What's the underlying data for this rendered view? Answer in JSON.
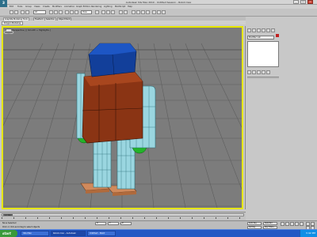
{
  "app": {
    "logo_text": "3",
    "title": "Autodesk 3ds Max 2010 - Untitled Session - Robot.max"
  },
  "window_controls": {
    "minimize": "_",
    "maximize": "□",
    "close": "×"
  },
  "menubar": {
    "items": [
      "Edit",
      "Tools",
      "Group",
      "Views",
      "Create",
      "Modifiers",
      "Animation",
      "Graph Editors",
      "Rendering",
      "Lighting",
      "MAXScript",
      "Help"
    ]
  },
  "toolbar": {
    "selection_filter": "All",
    "reference_coord": "View"
  },
  "ribbon": {
    "tabs": [
      "Graphite Modeling Tools",
      "Freeform",
      "Selection",
      "Object Paint"
    ],
    "active_tab": 0,
    "subtab": "Polygon Modeling"
  },
  "viewport": {
    "label": "[ + ] [ Perspective ] [ Smooth + Highlights ]"
  },
  "command_panel": {
    "object_name": "Modifier List",
    "color_swatch": "#c02020"
  },
  "timeline": {
    "frame_display": "0 / 100",
    "current_frame": 0,
    "total_frames": 100
  },
  "status": {
    "selection": "None Selected",
    "prompt": "Click or click-and-drag to select objects",
    "x_value": "X:",
    "y_value": "Y:",
    "z_value": "Z:",
    "auto_key": "Auto Key",
    "selected_label": "Selected",
    "set_key": "Set Key",
    "key_filters": "Key Filters..."
  },
  "taskbar": {
    "start_label": "start",
    "items": [
      "3ds Max",
      "Robot.max - Autodesk",
      "Untitled - Paint"
    ],
    "clock": "3:42 PM"
  },
  "colors": {
    "viewport_bg": "#7c7c7c",
    "viewport_border": "#e6e600",
    "grid_line": "#5e5e5e",
    "hat": "#123f9a",
    "body": "#8a3414",
    "limb": "#9ad6e0",
    "joint": "#23b32a",
    "shoe": "#d08a5c",
    "taskbar": "#2458c4"
  }
}
